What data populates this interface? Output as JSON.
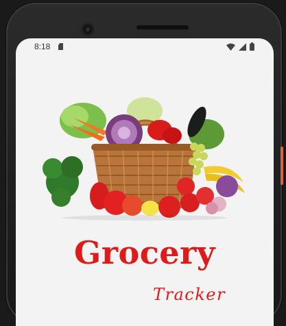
{
  "status_bar": {
    "time": "8:18",
    "icons": [
      "sim-card-icon",
      "wifi-icon",
      "cell-signal-icon",
      "battery-icon"
    ]
  },
  "hero": {
    "image": "grocery-basket-illustration"
  },
  "branding": {
    "title": "Grocery",
    "subtitle": "Tracker",
    "accent_color": "#dd1b1b"
  }
}
